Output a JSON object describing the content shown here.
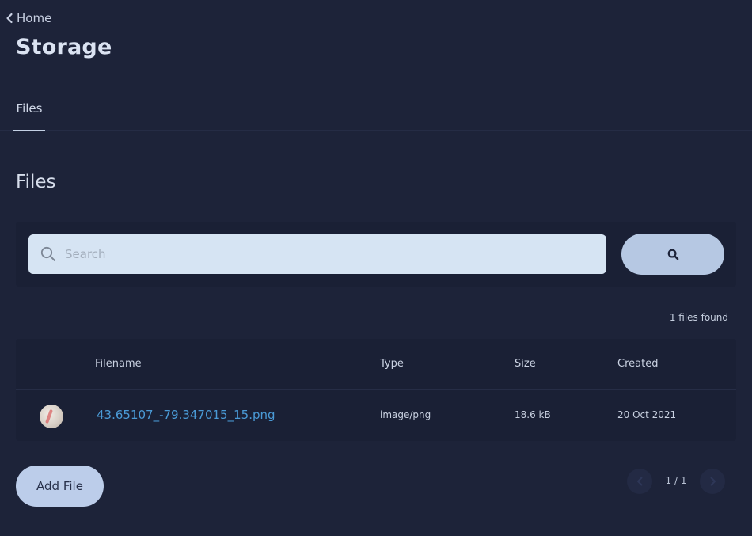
{
  "breadcrumb": {
    "label": "Home"
  },
  "page": {
    "title": "Storage"
  },
  "tabs": [
    {
      "label": "Files",
      "active": true
    }
  ],
  "section": {
    "title": "Files"
  },
  "search": {
    "placeholder": "Search",
    "value": ""
  },
  "results": {
    "count_text": "1 files found"
  },
  "table": {
    "headers": {
      "filename": "Filename",
      "type": "Type",
      "size": "Size",
      "created": "Created"
    },
    "rows": [
      {
        "filename": "43.65107_-79.347015_15.png",
        "type": "image/png",
        "size": "18.6 kB",
        "created": "20 Oct 2021"
      }
    ]
  },
  "actions": {
    "add_file_label": "Add File"
  },
  "pagination": {
    "text": "1 / 1",
    "current": 1,
    "total": 1
  },
  "colors": {
    "background": "#1d2339",
    "accent": "#b6c8e3",
    "link": "#4a9ad6"
  },
  "icons": {
    "back": "chevron-left-icon",
    "search": "search-icon",
    "prev": "chevron-left-icon",
    "next": "chevron-right-icon"
  }
}
